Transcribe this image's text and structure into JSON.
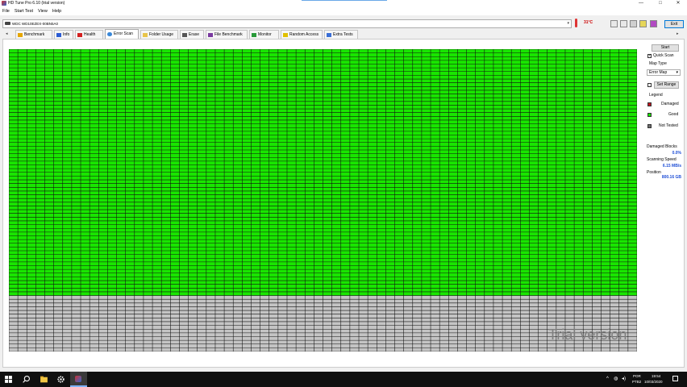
{
  "window": {
    "title": "HD Tune Pro 6.10 (trial version)",
    "controls": {
      "minimize": "—",
      "maximize": "□",
      "close": "✕"
    }
  },
  "menu": [
    "File",
    "Start Test",
    "View",
    "Help"
  ],
  "drive": {
    "selected": "WDC WD10EZEX-00BN5A0"
  },
  "temperature": "31°C",
  "toolbar": {
    "exit_label": "Exit"
  },
  "tabs": [
    {
      "label": "Benchmark",
      "icon": "benchmark-icon"
    },
    {
      "label": "Info",
      "icon": "info-icon"
    },
    {
      "label": "Health",
      "icon": "health-icon"
    },
    {
      "label": "Error Scan",
      "icon": "error-scan-icon",
      "active": true
    },
    {
      "label": "Folder Usage",
      "icon": "folder-icon"
    },
    {
      "label": "Erase",
      "icon": "erase-icon"
    },
    {
      "label": "File Benchmark",
      "icon": "file-benchmark-icon"
    },
    {
      "label": "Monitor",
      "icon": "monitor-icon"
    },
    {
      "label": "Random Access",
      "icon": "random-access-icon"
    },
    {
      "label": "Extra Tests",
      "icon": "extra-tests-icon"
    }
  ],
  "error_scan": {
    "start_label": "Start",
    "quick_scan_label": "Quick Scan",
    "quick_scan_checked": true,
    "map_type_label": "Map Type",
    "map_type_value": "Error Map",
    "set_range_label": "Set Range",
    "set_range_checked": false,
    "legend_title": "Legend",
    "legend": [
      {
        "label": "Damaged",
        "color": "#c0141e"
      },
      {
        "label": "Good",
        "color": "#19e600"
      },
      {
        "label": "Not Tested",
        "color": "#6e6e6e"
      }
    ],
    "damaged_blocks_label": "Damaged Blocks",
    "damaged_blocks_value": "0.0%",
    "scanning_speed_label": "Scanning Speed",
    "scanning_speed_value": "6.15 MB/s",
    "position_label": "Position",
    "position_value": "800.16 GB",
    "map": {
      "columns": 70,
      "good_rows": 66,
      "not_tested_rows": 15,
      "good_color": "#19e600",
      "not_tested_color": "#c4c4c4",
      "grid_color": "#111111"
    },
    "watermark": "Trial version"
  },
  "taskbar": {
    "language_top": "POR",
    "language_bottom": "PTB2",
    "time": "19:54",
    "date": "10/03/2020"
  }
}
